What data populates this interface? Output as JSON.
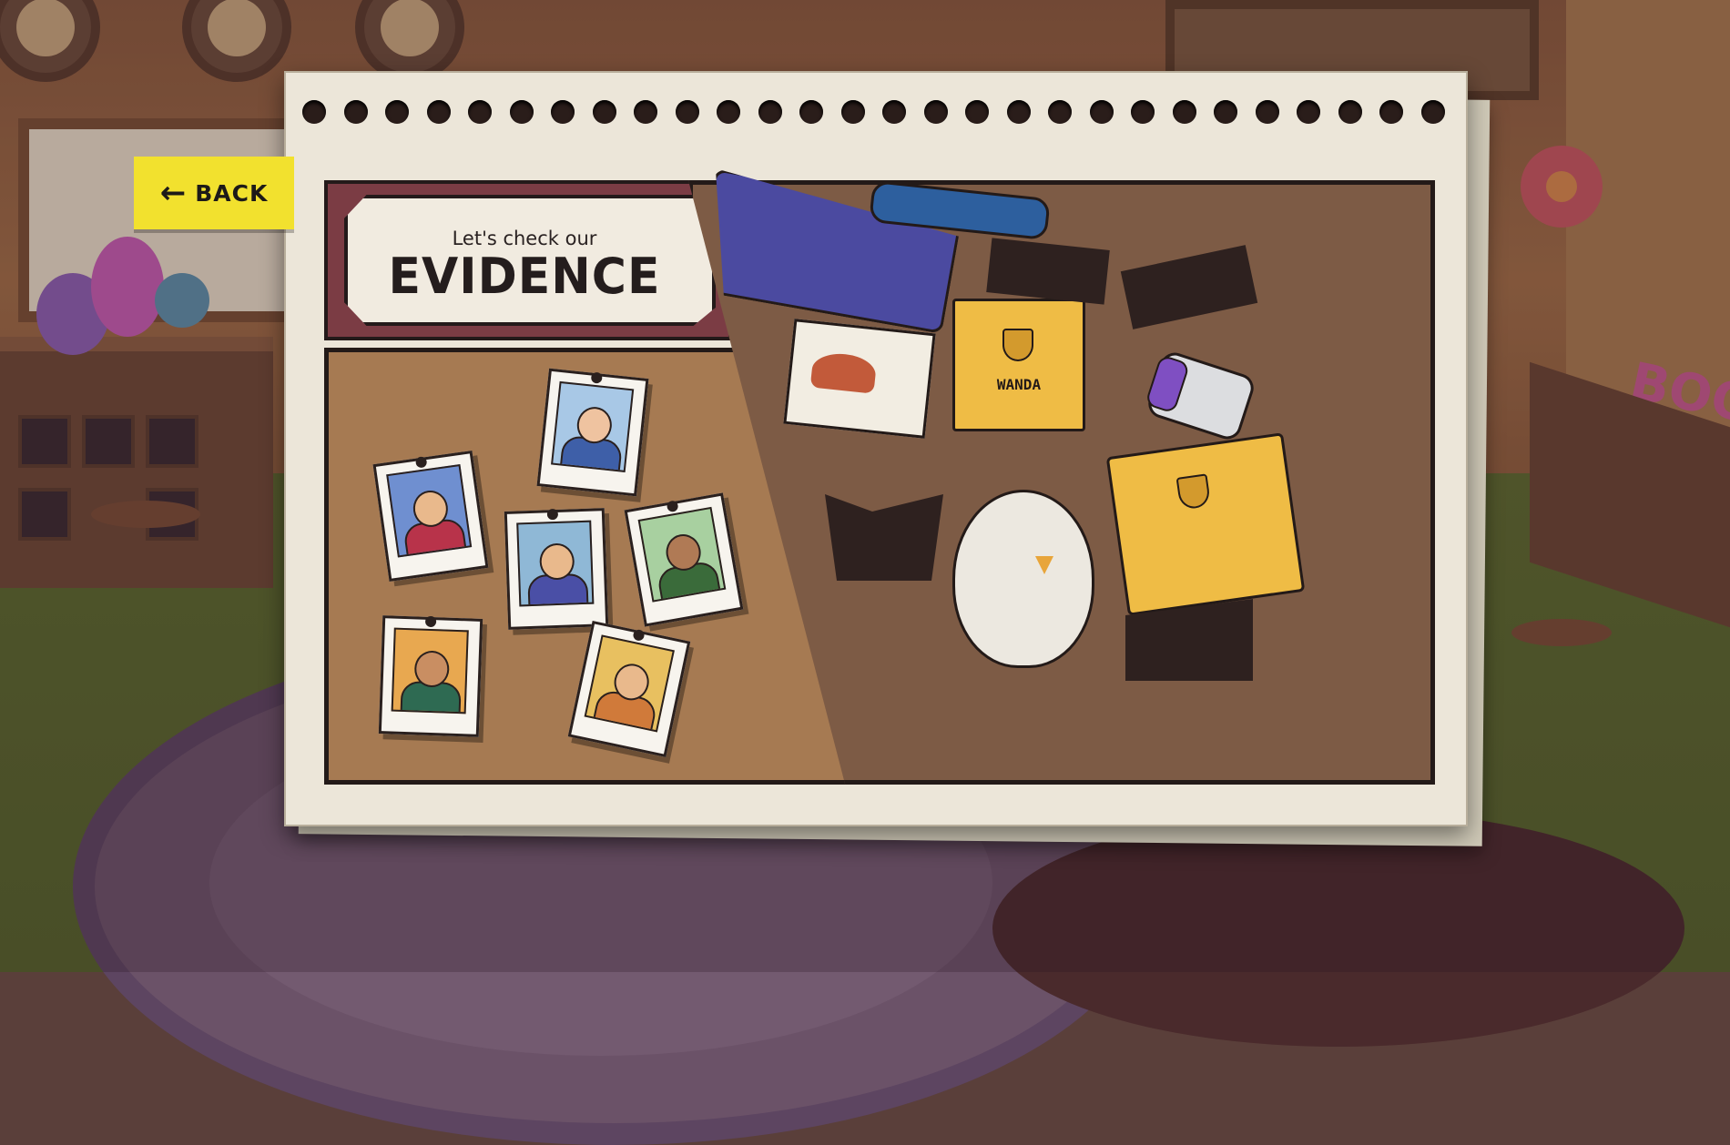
{
  "back_button": {
    "label": "BACK",
    "icon": "arrow-left-icon"
  },
  "evidence_header": {
    "subtitle": "Let's check our",
    "title": "EVIDENCE"
  },
  "scene": {
    "folder_label": "WANDA",
    "background_sign": "BOO"
  },
  "suspects": [
    {
      "id": "suspect-officer",
      "uniform_color": "#b8334a",
      "bg": "#6f8fd0"
    },
    {
      "id": "suspect-grandma",
      "uniform_color": "#3e5fa8",
      "bg": "#a8c8e6"
    },
    {
      "id": "suspect-mother-child",
      "uniform_color": "#4a4fa6",
      "bg": "#8fb8d6"
    },
    {
      "id": "suspect-soldier",
      "uniform_color": "#3a6b3a",
      "bg": "#a8d0a0"
    },
    {
      "id": "suspect-mustache-man",
      "uniform_color": "#2e6a52",
      "bg": "#e8a850"
    },
    {
      "id": "suspect-woman-glasses",
      "uniform_color": "#d07a3a",
      "bg": "#e8c060"
    }
  ],
  "colors": {
    "accent_yellow": "#f2e12e",
    "banner_red": "#7b3c44",
    "paper": "#ece6d9"
  }
}
